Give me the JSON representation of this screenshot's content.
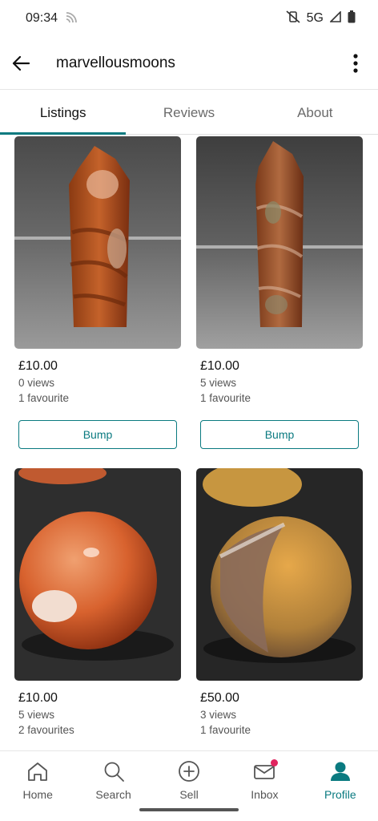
{
  "status_bar": {
    "time": "09:34",
    "network": "5G"
  },
  "app_bar": {
    "title": "marvellousmoons"
  },
  "tabs": [
    {
      "label": "Listings",
      "active": true
    },
    {
      "label": "Reviews",
      "active": false
    },
    {
      "label": "About",
      "active": false
    }
  ],
  "listings": [
    {
      "price": "£10.00",
      "views": "0 views",
      "favourites": "1 favourite",
      "bump_label": "Bump",
      "photo": "orange crystal tower"
    },
    {
      "price": "£10.00",
      "views": "5 views",
      "favourites": "1 favourite",
      "bump_label": "Bump",
      "photo": "banded jasper tower"
    },
    {
      "price": "£10.00",
      "views": "5 views",
      "favourites": "2 favourites",
      "photo": "carnelian sphere"
    },
    {
      "price": "£50.00",
      "views": "3 views",
      "favourites": "1 favourite",
      "photo": "ocean jasper sphere"
    }
  ],
  "bottom_nav": [
    {
      "label": "Home",
      "icon": "home-icon",
      "active": false
    },
    {
      "label": "Search",
      "icon": "search-icon",
      "active": false
    },
    {
      "label": "Sell",
      "icon": "plus-circle-icon",
      "active": false
    },
    {
      "label": "Inbox",
      "icon": "mail-icon",
      "active": false,
      "badge": true
    },
    {
      "label": "Profile",
      "icon": "person-icon",
      "active": true
    }
  ],
  "colors": {
    "accent": "#0a7a80",
    "badge": "#e0245e"
  }
}
